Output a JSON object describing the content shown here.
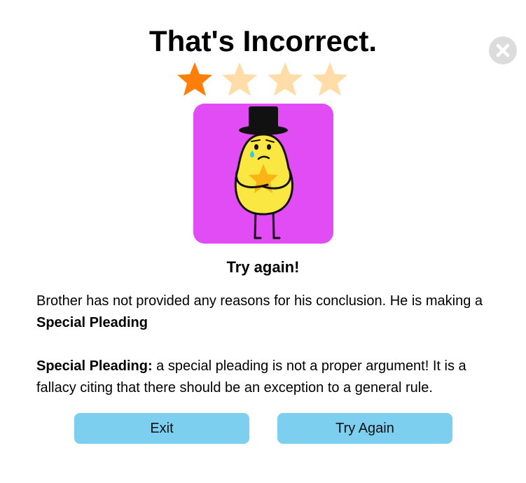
{
  "dialog": {
    "title": "That's Incorrect.",
    "subtitle": "Try again!",
    "rating": {
      "filled": 1,
      "total": 4
    },
    "colors": {
      "star_filled": "#ff7f0a",
      "star_empty": "#ffdca8",
      "card_background": "#e24cf5",
      "button_background": "#7ccfee"
    },
    "illustration_icon": "sad-potato-with-top-hat-holding-star-icon",
    "explanation": {
      "text": "Brother has not provided any reasons for his conclusion. He is making a ",
      "term": "Special Pleading"
    },
    "definition": {
      "term": "Special Pleading:",
      "text": " a special pleading is not a proper argument! It is a fallacy citing that there should be an exception to a general rule."
    },
    "buttons": {
      "exit_label": "Exit",
      "try_again_label": "Try Again"
    }
  }
}
